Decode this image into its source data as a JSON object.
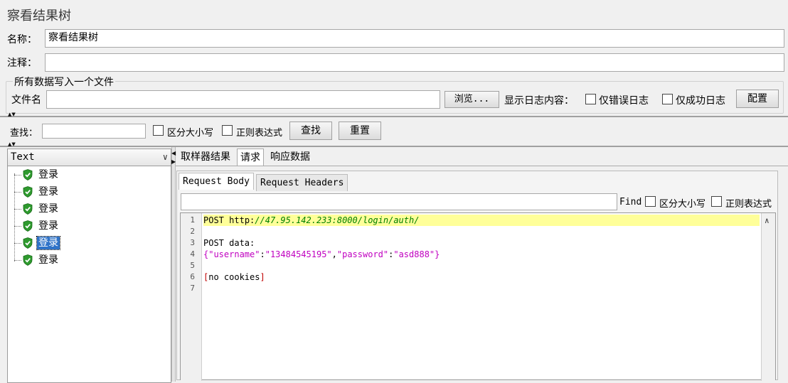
{
  "title": "察看结果树",
  "name_label": "名称：",
  "name_value": "察看结果树",
  "comment_label": "注释：",
  "comment_value": "",
  "file_group": {
    "legend": "所有数据写入一个文件",
    "filename_label": "文件名",
    "filename_value": "",
    "browse_label": "浏览...",
    "log_label": "显示日志内容：",
    "errors_only_label": "仅错误日志",
    "success_only_label": "仅成功日志",
    "configure_label": "配置"
  },
  "search": {
    "label": "查找：",
    "value": "",
    "case_label": "区分大小写",
    "regex_label": "正则表达式",
    "find_label": "查找",
    "reset_label": "重置"
  },
  "renderer": {
    "selected": "Text"
  },
  "tree": {
    "items": [
      {
        "label": "登录",
        "status": "success"
      },
      {
        "label": "登录",
        "status": "success"
      },
      {
        "label": "登录",
        "status": "success"
      },
      {
        "label": "登录",
        "status": "success"
      },
      {
        "label": "登录",
        "status": "success",
        "selected": true
      },
      {
        "label": "登录",
        "status": "success"
      }
    ]
  },
  "tabs": [
    "取样器结果",
    "请求",
    "响应数据"
  ],
  "active_tab": "请求",
  "inner_tabs": [
    "Request Body",
    "Request Headers"
  ],
  "active_inner_tab": "Request Body",
  "find": {
    "value": "",
    "label": "Find",
    "case_label": "区分大小写",
    "regex_label": "正则表达式"
  },
  "editor": {
    "lines": [
      {
        "num": "1",
        "method": "POST",
        "url_prefix": "http:",
        "url_rest": "//47.95.142.233:8000/login/auth/"
      },
      {
        "num": "2"
      },
      {
        "num": "3",
        "text": "POST data:"
      },
      {
        "num": "4",
        "json_open": "{",
        "k1": "\"username\"",
        "colon1": ":",
        "v1": "\"13484545195\"",
        "comma": ",",
        "k2": "\"password\"",
        "colon2": ":",
        "v2": "\"asd888\"",
        "json_close": "}"
      },
      {
        "num": "5"
      },
      {
        "num": "6",
        "open": "[",
        "text": "no cookies",
        "close": "]"
      },
      {
        "num": "7"
      }
    ]
  },
  "colors": {
    "selection": "#2f73c8",
    "highlight_line": "#ffff99",
    "json_key": "#c000c0",
    "json_value": "#c000c0",
    "url": "#008000",
    "success_icon": "#2e9a2e"
  }
}
